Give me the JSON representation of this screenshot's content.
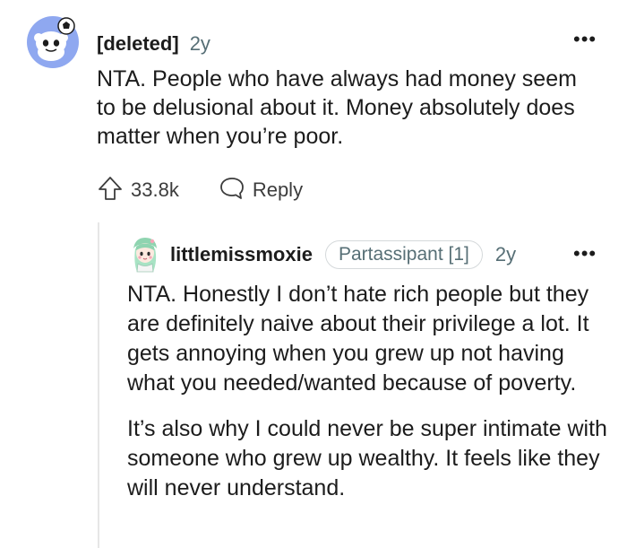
{
  "comments": [
    {
      "author": "[deleted]",
      "age": "2y",
      "more": "•••",
      "body": "NTA. People who have always had money seem to be delusional about it. Money absolutely does matter when you’re poor.",
      "votes": "33.8k",
      "reply_label": "Reply",
      "icons": {
        "avatar": "snoo-avatar-icon",
        "upvote": "upvote-arrow-icon",
        "reply": "speech-bubble-icon"
      }
    },
    {
      "author": "littlemissmoxie",
      "flair": "Partassipant [1]",
      "age": "2y",
      "more": "•••",
      "paragraphs": [
        "NTA. Honestly I don’t hate rich people but they are definitely naive about their privilege a lot. It gets annoying when you grew up not having what you needed/wanted because of poverty.",
        "It’s also why I could never be super intimate with someone who grew up wealthy. It feels like they will never understand."
      ],
      "icons": {
        "avatar": "user-avatar-icon"
      }
    }
  ],
  "colors": {
    "text": "#1c1c1c",
    "muted": "#576f76",
    "avatar_bg": "#8fa8f0",
    "flair_border": "#d5d9db",
    "thread_line": "#e6e6e6"
  }
}
